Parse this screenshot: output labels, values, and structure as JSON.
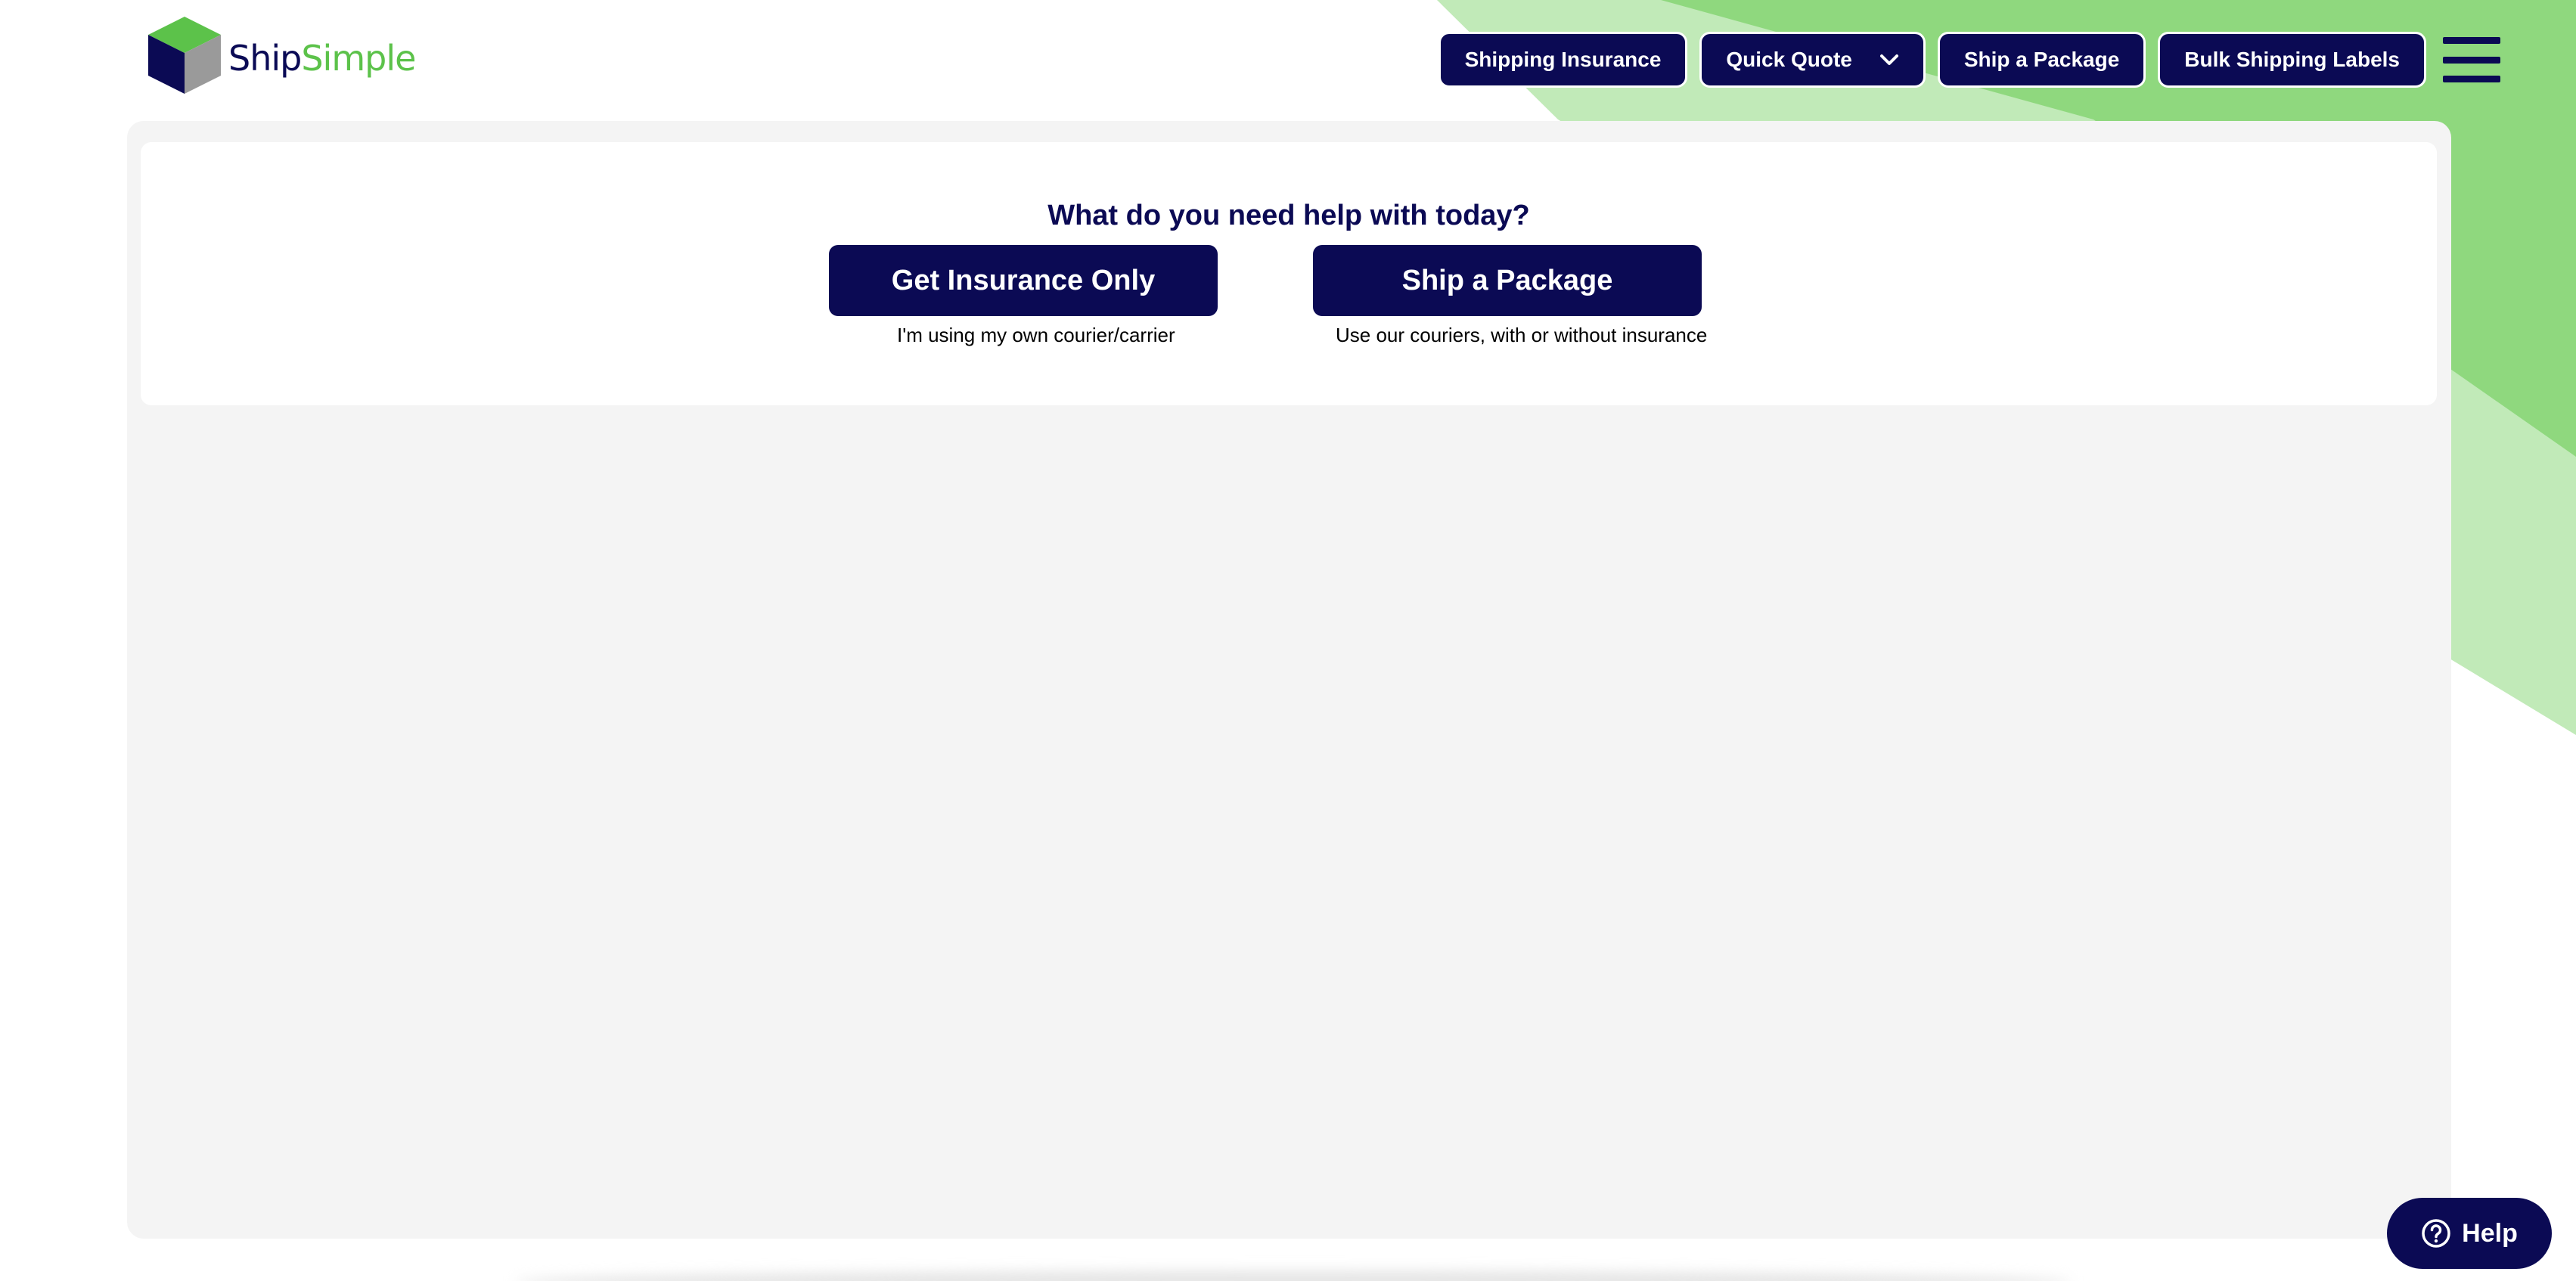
{
  "brand": {
    "name_part1": "Ship",
    "name_part2": "Simple"
  },
  "nav": {
    "shipping_insurance": "Shipping Insurance",
    "quick_quote": "Quick Quote",
    "ship_a_package": "Ship a Package",
    "bulk_shipping_labels": "Bulk Shipping Labels"
  },
  "main": {
    "title": "What do you need help with today?",
    "options": [
      {
        "label": "Get Insurance Only",
        "subtitle": "I'm using my own courier/carrier"
      },
      {
        "label": "Ship a Package",
        "subtitle": "Use our couriers, with or without insurance"
      }
    ]
  },
  "help": {
    "label": "Help"
  },
  "icons": {
    "logo": "box-cube-icon",
    "dropdown": "chevron-down-icon",
    "menu": "hamburger-menu-icon",
    "help": "question-circle-icon"
  },
  "colors": {
    "navy": "#0b0a54",
    "green_dark": "#8fd87e",
    "green_light": "#c1eab8",
    "panel_bg": "#f4f4f4"
  }
}
